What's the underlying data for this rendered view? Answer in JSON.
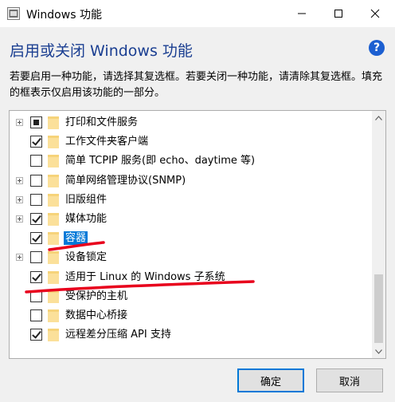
{
  "window": {
    "title": "Windows 功能",
    "controls": {
      "minimize": "minimize-icon",
      "maximize": "maximize-icon",
      "close": "close-icon"
    }
  },
  "header": {
    "heading": "启用或关闭 Windows 功能",
    "help_icon": "?",
    "description": "若要启用一种功能，请选择其复选框。若要关闭一种功能，请清除其复选框。填充的框表示仅启用该功能的一部分。"
  },
  "features": [
    {
      "label": "打印和文件服务",
      "expandable": true,
      "state": "partial",
      "selected": false
    },
    {
      "label": "工作文件夹客户端",
      "expandable": false,
      "state": "checked",
      "selected": false
    },
    {
      "label": "简单 TCPIP 服务(即 echo、daytime 等)",
      "expandable": false,
      "state": "unchecked",
      "selected": false
    },
    {
      "label": "简单网络管理协议(SNMP)",
      "expandable": true,
      "state": "unchecked",
      "selected": false
    },
    {
      "label": "旧版组件",
      "expandable": true,
      "state": "unchecked",
      "selected": false
    },
    {
      "label": "媒体功能",
      "expandable": true,
      "state": "checked",
      "selected": false
    },
    {
      "label": "容器",
      "expandable": false,
      "state": "checked",
      "selected": true
    },
    {
      "label": "设备锁定",
      "expandable": true,
      "state": "unchecked",
      "selected": false
    },
    {
      "label": "适用于 Linux 的 Windows 子系统",
      "expandable": false,
      "state": "checked",
      "selected": false
    },
    {
      "label": "受保护的主机",
      "expandable": false,
      "state": "unchecked",
      "selected": false
    },
    {
      "label": "数据中心桥接",
      "expandable": false,
      "state": "unchecked",
      "selected": false
    },
    {
      "label": "远程差分压缩 API 支持",
      "expandable": false,
      "state": "checked",
      "selected": false
    }
  ],
  "buttons": {
    "ok": "确定",
    "cancel": "取消"
  },
  "colors": {
    "heading": "#1a3e91",
    "selection": "#0078d7",
    "annotation": "#e8001c",
    "folder": "#f6d37a"
  }
}
